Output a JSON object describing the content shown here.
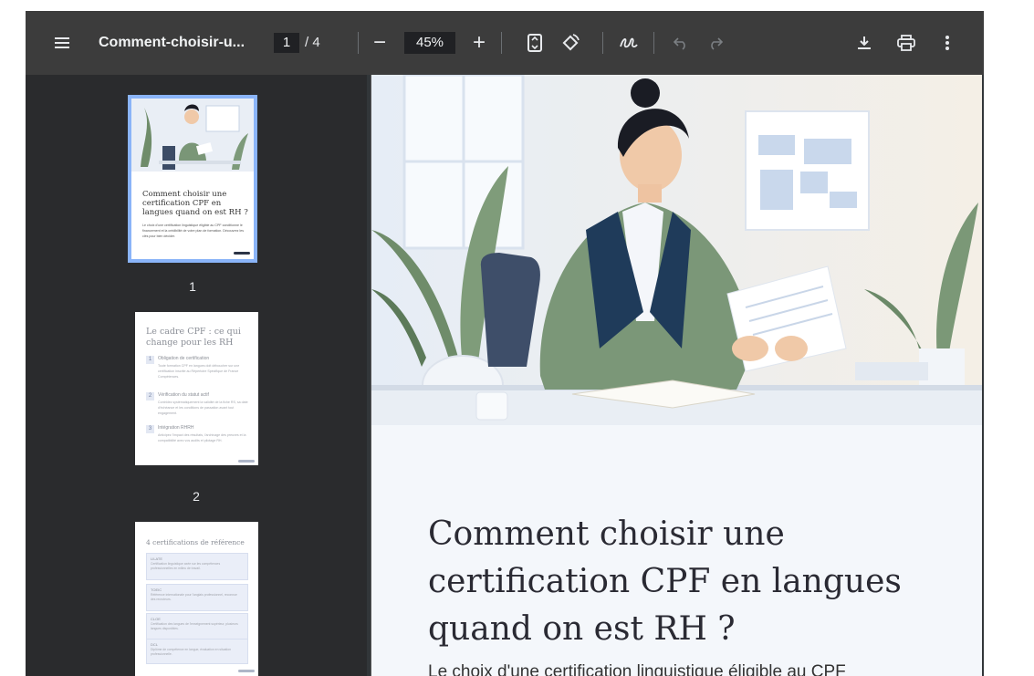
{
  "toolbar": {
    "menu_icon": "hamburger-menu-icon",
    "title": "Comment-choisir-u...",
    "current_page": "1",
    "page_separator": "/ 4",
    "zoom_out_label": "−",
    "zoom": "45%",
    "zoom_in_label": "+",
    "fit_icon": "fit-page-icon",
    "rotate_icon": "rotate-icon",
    "annotate_icon": "draw-icon",
    "undo_icon": "undo-icon",
    "redo_icon": "redo-icon",
    "download_icon": "download-icon",
    "print_icon": "print-icon",
    "more_icon": "more-vert-icon"
  },
  "thumbnails": [
    {
      "number": "1",
      "selected": true,
      "title": "Comment choisir une certification CPF en langues quand on est RH ?",
      "text": "Le choix d'une certification linguistique éligible au CPF conditionne le financement et la crédibilité de votre plan de formation. Découvrez les clés pour bien décider."
    },
    {
      "number": "2",
      "title": "Le cadre CPF : ce qui change pour les RH",
      "items": [
        {
          "num": "1",
          "heading": "Obligation de certification",
          "text": "Toute formation CPF en langues doit déboucher sur une certification inscrite au Répertoire Spécifique de France Compétences."
        },
        {
          "num": "2",
          "heading": "Vérification du statut actif",
          "text": "Contrôlez systématiquement la validité de la fiche RS, sa date d'échéance et les conditions de passation avant tout engagement."
        },
        {
          "num": "3",
          "heading": "Intégration RHRH",
          "text": "Anticipez l'impact des résultats, l'archivage des preuves et la compatibilité avec vos audits et pilotage RH."
        }
      ]
    },
    {
      "number": "3",
      "title": "4 certifications de référence",
      "items": [
        {
          "heading": "LILATE",
          "text": "Certification linguistique axée sur les compétences professionnelles en milieu de travail."
        },
        {
          "heading": "TOEIC",
          "text": "Référence internationale pour l'anglais professionnel, reconnue des recruteurs."
        },
        {
          "heading": "CLOE",
          "text": "Certification des langues de l'enseignement supérieur, plusieurs langues disponibles."
        },
        {
          "heading": "DCL",
          "text": "Diplôme de compétence en langue, évaluation en situation professionnelle."
        }
      ]
    }
  ],
  "document": {
    "title": "Comment choisir une certification CPF en langues quand on est RH ?",
    "body_partial": "Le choix d'une certification linguistique éligible au CPF"
  },
  "colors": {
    "toolbar_bg": "#3c3c3c",
    "sidebar_bg": "#2a2b2d",
    "viewer_bg": "#323639",
    "thumb_selected_border": "#8ab4f8"
  }
}
